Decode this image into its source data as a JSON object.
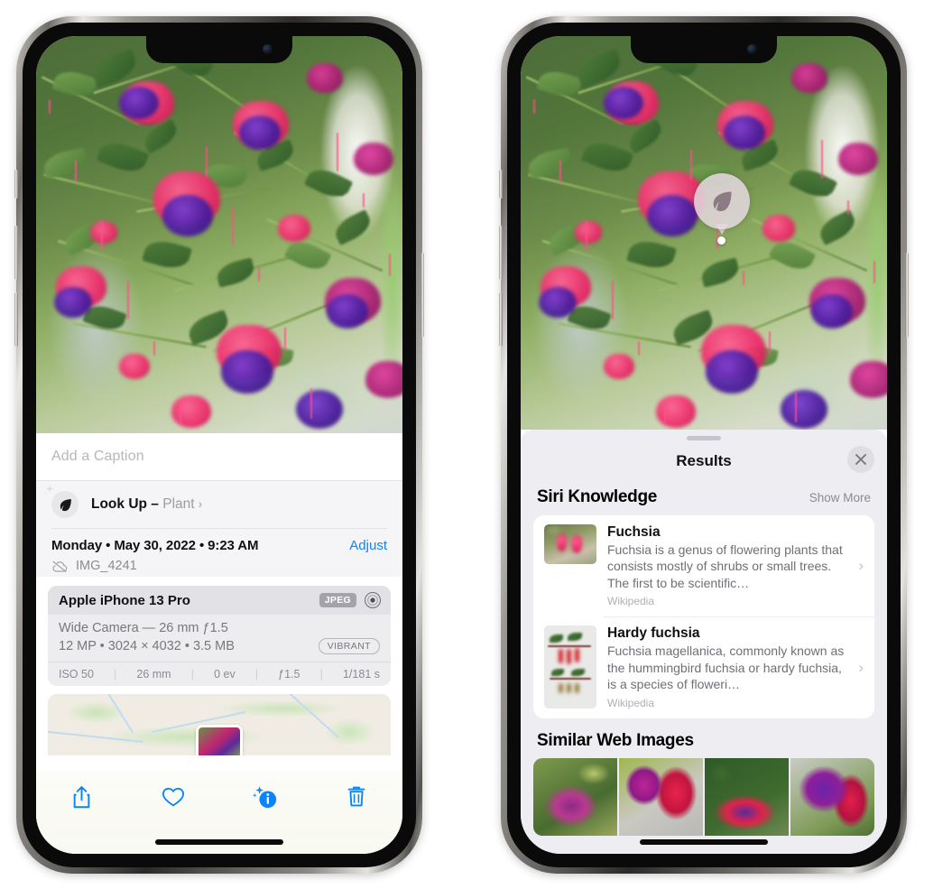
{
  "left_phone": {
    "caption": {
      "placeholder": "Add a Caption",
      "value": ""
    },
    "lookup": {
      "icon": "leaf-icon",
      "label": "Look Up – ",
      "subject": "Plant",
      "chevron": "›"
    },
    "meta": {
      "date": "Monday • May 30, 2022 • 9:23 AM",
      "adjust_label": "Adjust",
      "cloud_icon": "cloud-slash-icon",
      "filename": "IMG_4241"
    },
    "camera": {
      "device": "Apple iPhone 13 Pro",
      "format_chip": "JPEG",
      "lens_icon": "lens-icon",
      "lens_line": "Wide Camera — 26 mm ƒ1.5",
      "size_line": "12 MP • 3024 × 4032 • 3.5 MB",
      "style_chip": "VIBRANT",
      "exif": [
        "ISO 50",
        "26 mm",
        "0 ev",
        "ƒ1.5",
        "1/181 s"
      ],
      "separator": "|"
    },
    "toolbar": [
      {
        "name": "share-button",
        "icon": "share-icon"
      },
      {
        "name": "favorite-button",
        "icon": "heart-icon"
      },
      {
        "name": "info-button",
        "icon": "info-sparkle-icon"
      },
      {
        "name": "delete-button",
        "icon": "trash-icon"
      }
    ]
  },
  "right_phone": {
    "vlu_badge": {
      "icon": "leaf-icon"
    },
    "sheet": {
      "title": "Results",
      "close_icon": "close-icon",
      "siri": {
        "heading": "Siri Knowledge",
        "action": "Show More",
        "cards": [
          {
            "title": "Fuchsia",
            "desc": "Fuchsia is a genus of flowering plants that consists mostly of shrubs or small trees. The first to be scientific…",
            "source": "Wikipedia",
            "chevron": "›"
          },
          {
            "title": "Hardy fuchsia",
            "desc": "Fuchsia magellanica, commonly known as the hummingbird fuchsia or hardy fuchsia, is a species of floweri…",
            "source": "Wikipedia",
            "chevron": "›"
          }
        ]
      },
      "similar": {
        "heading": "Similar Web Images",
        "count": 4
      }
    }
  },
  "colors": {
    "accent_blue": "#0b84ff",
    "sheet_bg": "#eeeef2",
    "card_bg": "#ffffff",
    "secondary_text": "#8a8a90",
    "badge_gray": "#a3a3a9"
  }
}
